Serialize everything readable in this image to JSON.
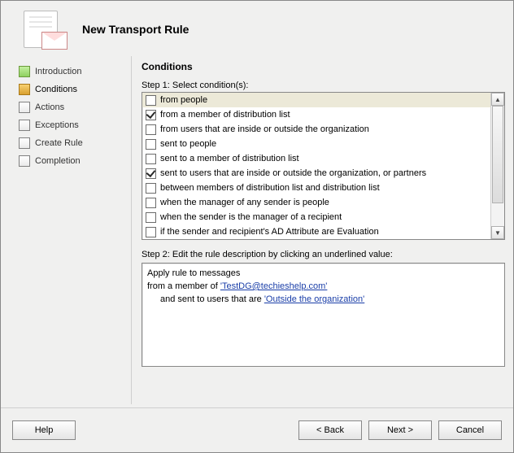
{
  "header": {
    "title": "New Transport Rule"
  },
  "sidebar": [
    "Introduction",
    "Conditions",
    "Actions",
    "Exceptions",
    "Create Rule",
    "Completion"
  ],
  "main": {
    "heading": "Conditions",
    "step1_label": "Step 1: Select condition(s):",
    "step2_label": "Step 2: Edit the rule description by clicking an underlined value:"
  },
  "conditions": [
    {
      "label": "from people",
      "checked": false,
      "selected": true
    },
    {
      "label": "from a member of distribution list",
      "checked": true
    },
    {
      "label": "from users that are inside or outside the organization",
      "checked": false
    },
    {
      "label": "sent to people",
      "checked": false
    },
    {
      "label": "sent to a member of distribution list",
      "checked": false
    },
    {
      "label": "sent to users that are inside or outside the organization, or partners",
      "checked": true
    },
    {
      "label": "between members of distribution list and distribution list",
      "checked": false
    },
    {
      "label": "when the manager of any sender is people",
      "checked": false
    },
    {
      "label": "when the sender is the manager of a recipient",
      "checked": false
    },
    {
      "label": "if the sender and recipient's AD Attribute are Evaluation",
      "checked": false
    }
  ],
  "description": {
    "line1": "Apply rule to messages",
    "line2_prefix": "from a member of ",
    "line2_link": "'TestDG@techieshelp.com'",
    "line3_prefix": "and sent to users that are ",
    "line3_link": "'Outside the organization'"
  },
  "footer": {
    "help": "Help",
    "back": "< Back",
    "next": "Next >",
    "cancel": "Cancel"
  }
}
